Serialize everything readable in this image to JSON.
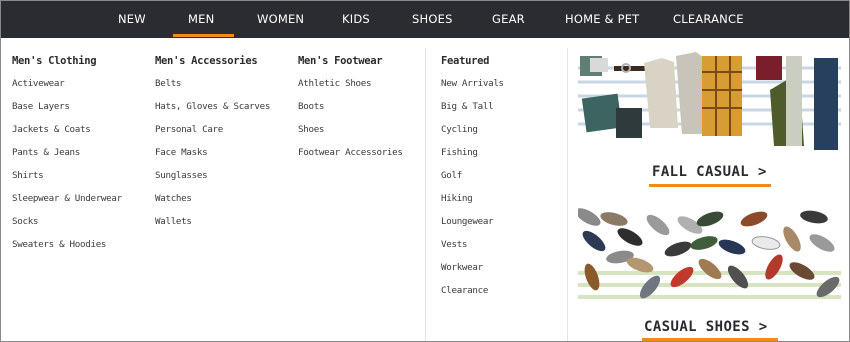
{
  "nav": {
    "items": [
      "NEW",
      "MEN",
      "WOMEN",
      "KIDS",
      "SHOES",
      "GEAR",
      "HOME & PET",
      "CLEARANCE"
    ],
    "active": "MEN"
  },
  "columns": [
    {
      "heading": "Men's Clothing",
      "links": [
        "Activewear",
        "Base Layers",
        "Jackets & Coats",
        "Pants & Jeans",
        "Shirts",
        "Sleepwear & Underwear",
        "Socks",
        "Sweaters & Hoodies"
      ]
    },
    {
      "heading": "Men's Accessories",
      "links": [
        "Belts",
        "Hats, Gloves & Scarves",
        "Personal Care",
        "Face Masks",
        "Sunglasses",
        "Watches",
        "Wallets"
      ]
    },
    {
      "heading": "Men's Footwear",
      "links": [
        "Athletic Shoes",
        "Boots",
        "Shoes",
        "Footwear Accessories"
      ]
    },
    {
      "heading": "Featured",
      "links": [
        "New Arrivals",
        "Big & Tall",
        "Cycling",
        "Fishing",
        "Golf",
        "Hiking",
        "Loungewear",
        "Vests",
        "Workwear",
        "Clearance"
      ]
    }
  ],
  "promos": [
    {
      "label": "FALL CASUAL >"
    },
    {
      "label": "CASUAL SHOES >"
    }
  ],
  "colors": {
    "nav_bg": "#2b2c31",
    "accent": "#f08a1c"
  }
}
